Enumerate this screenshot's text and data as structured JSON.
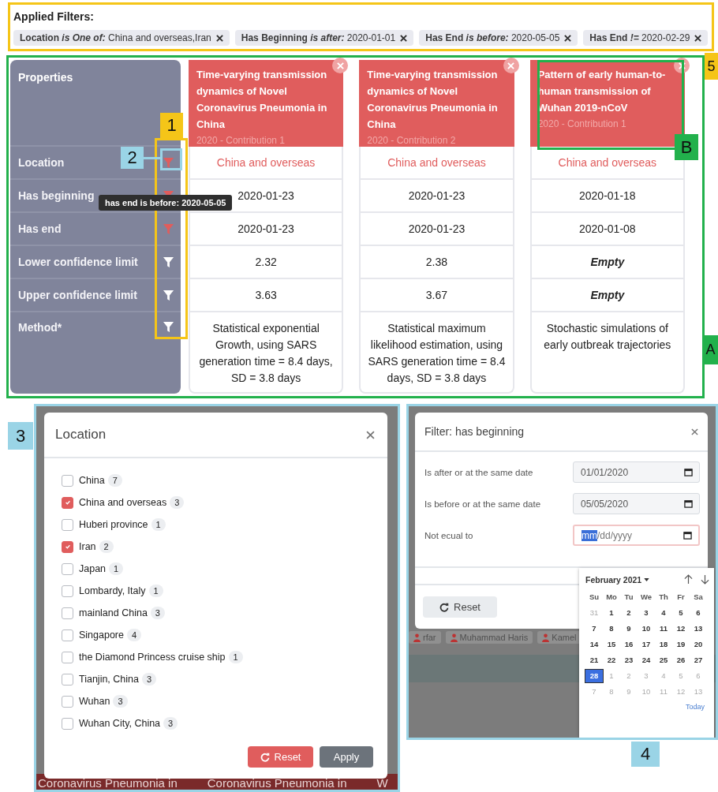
{
  "applied_filters": {
    "title": "Applied Filters:",
    "chips": [
      {
        "property": "Location",
        "operator": "is One of:",
        "value": "China and overseas,Iran"
      },
      {
        "property": "Has Beginning",
        "operator": "is after:",
        "value": "2020-01-01"
      },
      {
        "property": "Has End",
        "operator": "is before:",
        "value": "2020-05-05"
      },
      {
        "property": "Has End",
        "operator": "!=",
        "value": "2020-02-29"
      }
    ]
  },
  "comparison": {
    "properties_title": "Properties",
    "properties": [
      {
        "label": "Location",
        "filter_active": true
      },
      {
        "label": "Has beginning",
        "filter_active": true
      },
      {
        "label": "Has end",
        "filter_active": true
      },
      {
        "label": "Lower confidence limit",
        "filter_active": false
      },
      {
        "label": "Upper confidence limit",
        "filter_active": false
      },
      {
        "label": "Method*",
        "filter_active": false
      }
    ],
    "tooltip": "has end is before: 2020-05-05",
    "papers": [
      {
        "title": "Time-varying transmission dynamics of Novel Coronavirus Pneumonia in China",
        "subtitle": "2020 - Contribution 1",
        "values": [
          {
            "text": "China and overseas",
            "kind": "link"
          },
          {
            "text": "2020-01-23",
            "kind": "plain"
          },
          {
            "text": "2020-01-23",
            "kind": "plain"
          },
          {
            "text": "2.32",
            "kind": "plain"
          },
          {
            "text": "3.63",
            "kind": "plain"
          },
          {
            "text": "Statistical exponential Growth, using SARS generation time = 8.4 days, SD = 3.8 days",
            "kind": "plain"
          }
        ]
      },
      {
        "title": "Time-varying transmission dynamics of Novel Coronavirus Pneumonia in China",
        "subtitle": "2020 - Contribution 2",
        "values": [
          {
            "text": "China and overseas",
            "kind": "link"
          },
          {
            "text": "2020-01-23",
            "kind": "plain"
          },
          {
            "text": "2020-01-23",
            "kind": "plain"
          },
          {
            "text": "2.38",
            "kind": "plain"
          },
          {
            "text": "3.67",
            "kind": "plain"
          },
          {
            "text": "Statistical maximum likelihood estimation, using SARS generation time = 8.4 days, SD = 3.8 days",
            "kind": "plain"
          }
        ]
      },
      {
        "title": "Pattern of early human-to-human transmission of Wuhan 2019-nCoV",
        "subtitle": "2020 - Contribution 1",
        "values": [
          {
            "text": "China and overseas",
            "kind": "link"
          },
          {
            "text": "2020-01-18",
            "kind": "plain"
          },
          {
            "text": "2020-01-08",
            "kind": "plain"
          },
          {
            "text": "Empty",
            "kind": "empty"
          },
          {
            "text": "Empty",
            "kind": "empty"
          },
          {
            "text": "Stochastic simulations of early outbreak trajectories",
            "kind": "plain"
          }
        ]
      }
    ]
  },
  "location_dialog": {
    "title": "Location",
    "options": [
      {
        "label": "China",
        "count": "7",
        "checked": false
      },
      {
        "label": "China and overseas",
        "count": "3",
        "checked": true
      },
      {
        "label": "Huberi province",
        "count": "1",
        "checked": false
      },
      {
        "label": "Iran",
        "count": "2",
        "checked": true
      },
      {
        "label": "Japan",
        "count": "1",
        "checked": false
      },
      {
        "label": "Lombardy, Italy",
        "count": "1",
        "checked": false
      },
      {
        "label": "mainland China",
        "count": "3",
        "checked": false
      },
      {
        "label": "Singapore",
        "count": "4",
        "checked": false
      },
      {
        "label": "the Diamond Princess cruise ship",
        "count": "1",
        "checked": false
      },
      {
        "label": "Tianjin, China",
        "count": "3",
        "checked": false
      },
      {
        "label": "Wuhan",
        "count": "3",
        "checked": false
      },
      {
        "label": "Wuhan City, China",
        "count": "3",
        "checked": false
      }
    ],
    "reset": "Reset",
    "apply": "Apply",
    "backdrop_texts": [
      "Coronavirus Pneumonia in",
      "Coronavirus Pneumonia in",
      "W"
    ]
  },
  "date_dialog": {
    "title": "Filter: has beginning",
    "fields": [
      {
        "label": "Is after or at the same date",
        "value": "01/01/2020",
        "focused": false
      },
      {
        "label": "Is before or at the same date",
        "value": "05/05/2020",
        "focused": false
      },
      {
        "label": "Not ecual to",
        "placeholder": "mm/dd/yyyy",
        "focused": true
      }
    ],
    "reset": "Reset",
    "backdrop_authors": [
      "rfar",
      "Muhammad Haris",
      "Kamel"
    ],
    "calendar": {
      "month": "February 2021",
      "weekdays": [
        "Su",
        "Mo",
        "Tu",
        "We",
        "Th",
        "Fr",
        "Sa"
      ],
      "weeks": [
        [
          {
            "day": "31",
            "muted": true,
            "selected": false
          },
          {
            "day": "1",
            "muted": false,
            "selected": false
          },
          {
            "day": "2",
            "muted": false,
            "selected": false
          },
          {
            "day": "3",
            "muted": false,
            "selected": false
          },
          {
            "day": "4",
            "muted": false,
            "selected": false
          },
          {
            "day": "5",
            "muted": false,
            "selected": false
          },
          {
            "day": "6",
            "muted": false,
            "selected": false
          }
        ],
        [
          {
            "day": "7",
            "muted": false,
            "selected": false
          },
          {
            "day": "8",
            "muted": false,
            "selected": false
          },
          {
            "day": "9",
            "muted": false,
            "selected": false
          },
          {
            "day": "10",
            "muted": false,
            "selected": false
          },
          {
            "day": "11",
            "muted": false,
            "selected": false
          },
          {
            "day": "12",
            "muted": false,
            "selected": false
          },
          {
            "day": "13",
            "muted": false,
            "selected": false
          }
        ],
        [
          {
            "day": "14",
            "muted": false,
            "selected": false
          },
          {
            "day": "15",
            "muted": false,
            "selected": false
          },
          {
            "day": "16",
            "muted": false,
            "selected": false
          },
          {
            "day": "17",
            "muted": false,
            "selected": false
          },
          {
            "day": "18",
            "muted": false,
            "selected": false
          },
          {
            "day": "19",
            "muted": false,
            "selected": false
          },
          {
            "day": "20",
            "muted": false,
            "selected": false
          }
        ],
        [
          {
            "day": "21",
            "muted": false,
            "selected": false
          },
          {
            "day": "22",
            "muted": false,
            "selected": false
          },
          {
            "day": "23",
            "muted": false,
            "selected": false
          },
          {
            "day": "24",
            "muted": false,
            "selected": false
          },
          {
            "day": "25",
            "muted": false,
            "selected": false
          },
          {
            "day": "26",
            "muted": false,
            "selected": false
          },
          {
            "day": "27",
            "muted": false,
            "selected": false
          }
        ],
        [
          {
            "day": "28",
            "muted": false,
            "selected": true
          },
          {
            "day": "1",
            "muted": true,
            "selected": false
          },
          {
            "day": "2",
            "muted": true,
            "selected": false
          },
          {
            "day": "3",
            "muted": true,
            "selected": false
          },
          {
            "day": "4",
            "muted": true,
            "selected": false
          },
          {
            "day": "5",
            "muted": true,
            "selected": false
          },
          {
            "day": "6",
            "muted": true,
            "selected": false
          }
        ],
        [
          {
            "day": "7",
            "muted": true,
            "selected": false
          },
          {
            "day": "8",
            "muted": true,
            "selected": false
          },
          {
            "day": "9",
            "muted": true,
            "selected": false
          },
          {
            "day": "10",
            "muted": true,
            "selected": false
          },
          {
            "day": "11",
            "muted": true,
            "selected": false
          },
          {
            "day": "12",
            "muted": true,
            "selected": false
          },
          {
            "day": "13",
            "muted": true,
            "selected": false
          }
        ]
      ],
      "today": "Today"
    }
  },
  "callouts": {
    "filter_column": "1",
    "location_filter": "2",
    "location_dialog": "3",
    "date_dialog": "4",
    "applied_filters": "5",
    "comparison": "A",
    "paper_header": "B"
  }
}
